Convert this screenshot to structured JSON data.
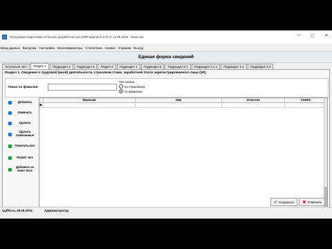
{
  "window": {
    "title": "Программа подготовки отчетных документов для ОФР версия 2.170 от 14.05.2024 - База №1"
  },
  "menu": [
    "Ввод данных",
    "Выгрузка",
    "Настройки",
    "Классификаторы",
    "Статистика",
    "Сервис",
    "Справка",
    "Выход"
  ],
  "form": {
    "title": "Единая форма сведений",
    "tabs": [
      "Титульный лист",
      "Раздел 1",
      "Подраздел 2",
      "Подраздел 3",
      "Раздел 2",
      "Подраздел 1",
      "Подраздел 2",
      "Подраздел 2.1",
      "Подраздел 2.1.1",
      "Подраздел 2.2",
      "Подраздел 2.3"
    ],
    "active_tab": 1,
    "section_title": "Раздел 1. Сведения о трудовой (иной) деятельности, страховом стаже, заработной плате зарегистрированного лица (ЗЛ)"
  },
  "search": {
    "label": "Поиск по фамилии:",
    "value": "",
    "type_label": "Тип поиска",
    "options": [
      "по страховому",
      "по фамилии"
    ],
    "selected": "по фамилии"
  },
  "side_buttons": [
    {
      "label": "Добавить",
      "icon": "add-icon",
      "color": "#2c6ed5"
    },
    {
      "label": "Изменить",
      "icon": "edit-icon",
      "color": "#2c6ed5"
    },
    {
      "label": "Удалить",
      "icon": "delete-icon",
      "color": "#2c6ed5"
    },
    {
      "label": "Удалить помеченные",
      "icon": "delete-marked-icon",
      "color": "#2c6ed5"
    },
    {
      "label": "Пометить все",
      "icon": "mark-all-icon",
      "color": "#2a9b3b"
    },
    {
      "label": "Размет. все",
      "icon": "unmark-all-icon",
      "color": "#2a9b3b"
    },
    {
      "label": "Добавить из анкет всех",
      "icon": "add-from-forms-icon",
      "color": "#2a9b3b"
    }
  ],
  "table": {
    "columns": [
      "",
      "Фамилия",
      "Имя",
      "Отчество",
      "СНИЛС"
    ],
    "rows": [
      {
        "marker": "▶",
        "cells": [
          "",
          "",
          "",
          ""
        ]
      }
    ]
  },
  "actions": {
    "save": "Сохранить",
    "cancel": "Отменить"
  },
  "status": {
    "date": "Суббота, 25.05.2024",
    "user": "Администратор"
  }
}
